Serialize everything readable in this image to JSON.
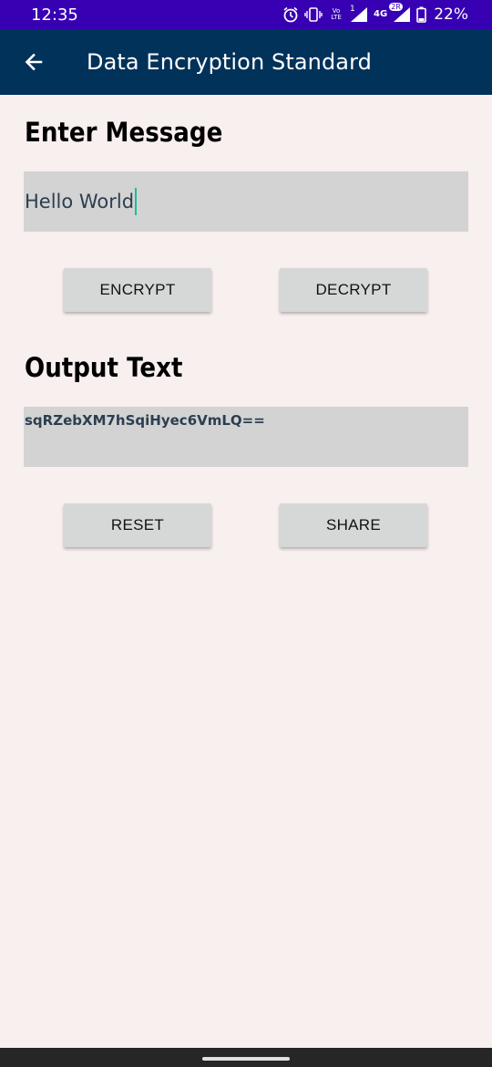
{
  "status_bar": {
    "time": "12:35",
    "battery_percent": "22%",
    "icons": [
      "alarm-icon",
      "vibrate-icon",
      "volte-icon",
      "signal-icon",
      "4g-icon",
      "signal-icon-2",
      "battery-icon"
    ],
    "volte_label": "Vo LTE",
    "sim1_label": "1",
    "network_label": "4G",
    "sim2_label": "2R"
  },
  "app_bar": {
    "title": "Data Encryption Standard",
    "back_icon": "arrow-left-icon"
  },
  "input_section": {
    "heading": "Enter Message",
    "message_value": "Hello World",
    "encrypt_label": "ENCRYPT",
    "decrypt_label": "DECRYPT"
  },
  "output_section": {
    "heading": "Output Text",
    "output_value": "sqRZebXM7hSqiHyec6VmLQ==",
    "reset_label": "RESET",
    "share_label": "SHARE"
  },
  "colors": {
    "status_bar": "#3700b3",
    "app_bar": "#01325a",
    "background": "#f8efef",
    "field": "#d3d3d3",
    "button": "#d6d7d7",
    "cursor": "#1abc9c"
  }
}
